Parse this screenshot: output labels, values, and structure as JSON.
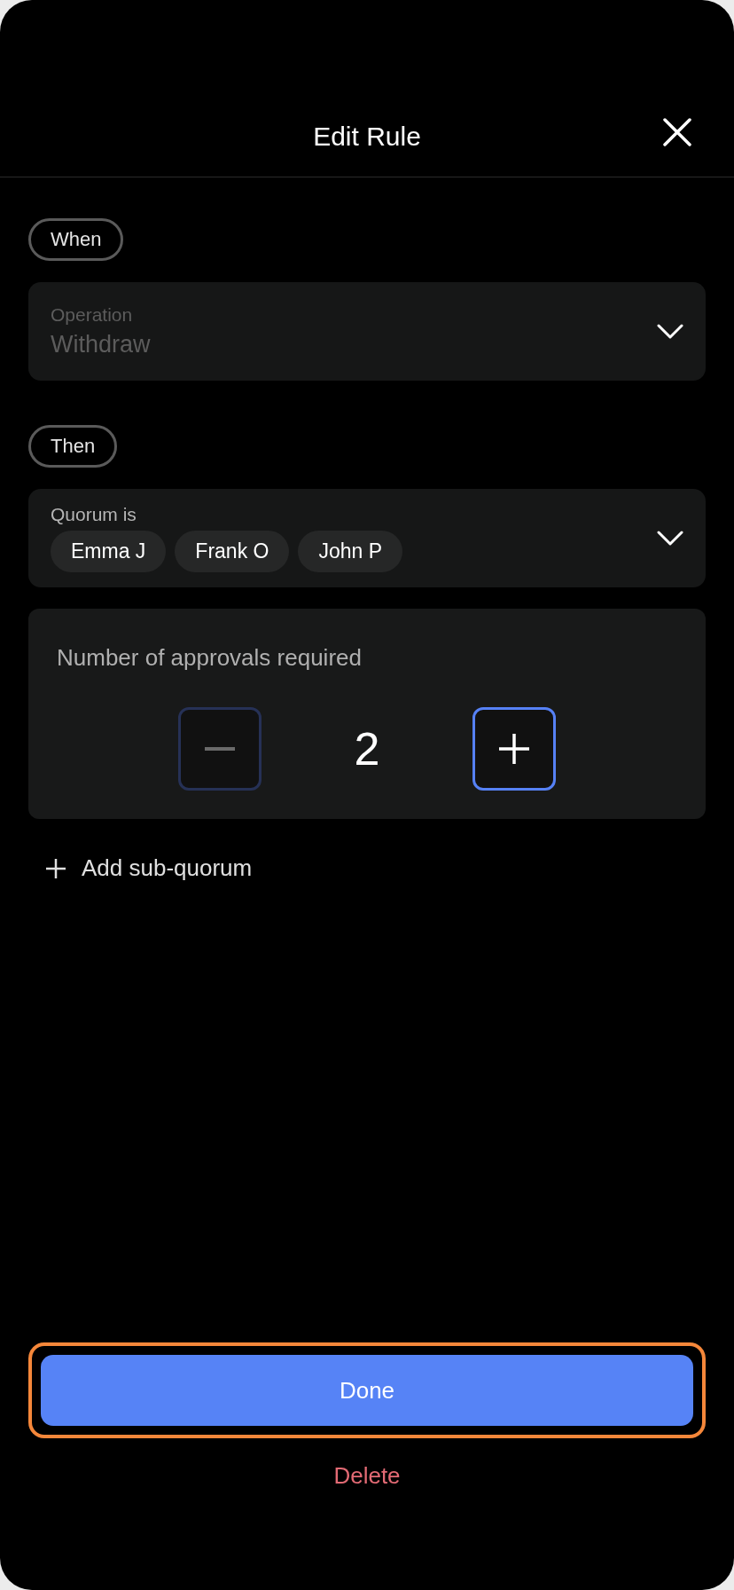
{
  "header": {
    "title": "Edit Rule"
  },
  "when": {
    "label": "When",
    "field": {
      "label": "Operation",
      "value": "Withdraw",
      "disabled": true
    }
  },
  "then": {
    "label": "Then",
    "field": {
      "label": "Quorum is",
      "chips": [
        "Emma J",
        "Frank O",
        "John P"
      ],
      "disabled": false
    }
  },
  "approvals": {
    "label": "Number of approvals required",
    "value": "2",
    "decrement_disabled": true,
    "increment_disabled": false
  },
  "add_link": {
    "label": "Add sub-quorum"
  },
  "done_button": {
    "label": "Done",
    "focused": true
  },
  "delete_button": {
    "label": "Delete"
  }
}
